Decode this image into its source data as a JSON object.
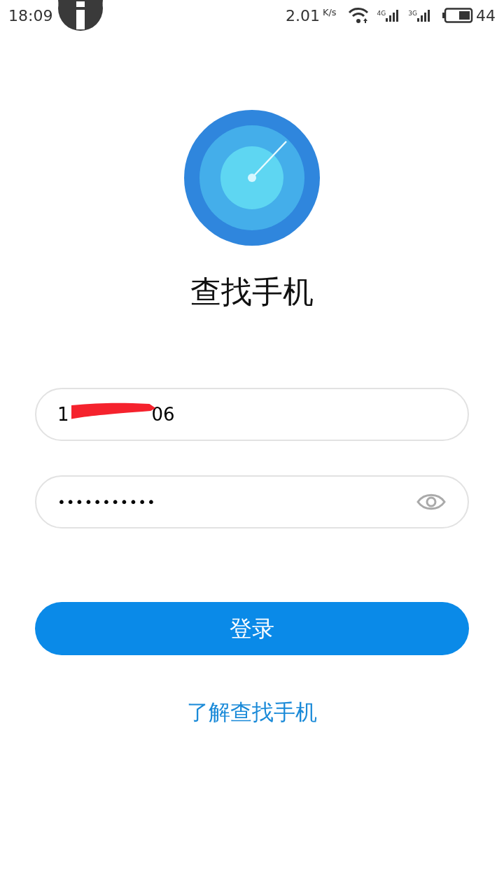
{
  "status_bar": {
    "time": "18:09",
    "speed": "2.01",
    "speed_unit": "K/s",
    "networks": [
      {
        "label": "4G"
      },
      {
        "label": "3G"
      }
    ],
    "battery": "44"
  },
  "app": {
    "title": "查找手机"
  },
  "phone_field": {
    "value_start": "1",
    "value_end": "06",
    "redacted": true
  },
  "password_field": {
    "value": "•••••••••••",
    "masked": true
  },
  "login_button": {
    "label": "登录"
  },
  "learn_more_link": {
    "label": "了解查找手机"
  }
}
